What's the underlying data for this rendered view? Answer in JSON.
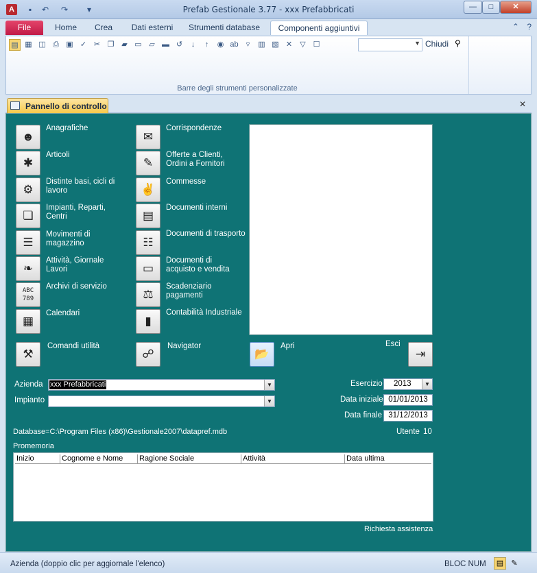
{
  "window": {
    "title": "Prefab Gestionale 3.77 - xxx Prefabbricati",
    "app_icon": "A"
  },
  "ribbon_tabs": [
    {
      "label": "File"
    },
    {
      "label": "Home"
    },
    {
      "label": "Crea"
    },
    {
      "label": "Dati esterni"
    },
    {
      "label": "Strumenti database"
    },
    {
      "label": "Componenti aggiuntivi"
    }
  ],
  "ribbon": {
    "close_label": "Chiudi",
    "group_label": "Barre degli strumenti personalizzate",
    "combo_value": ""
  },
  "doc_tab": {
    "label": "Pannello di controllo"
  },
  "panel": {
    "left_buttons": [
      {
        "label": "Anagrafiche",
        "icon": "person-icon"
      },
      {
        "label": "Articoli",
        "icon": "tools-icon"
      },
      {
        "label": "Distinte basi, cicli di lavoro",
        "icon": "wrench-icon"
      },
      {
        "label": "Impianti,  Reparti, Centri",
        "icon": "squares-icon"
      },
      {
        "label": "Movimenti di magazzino",
        "icon": "list-icon"
      },
      {
        "label": "Attività, Giornale Lavori",
        "icon": "journal-icon"
      },
      {
        "label": "Archivi di servizio",
        "icon": "abc-icon"
      },
      {
        "label": "Calendari",
        "icon": "calendar-icon"
      }
    ],
    "right_buttons": [
      {
        "label": "Corrispondenze",
        "icon": "mail-icon"
      },
      {
        "label": "Offerte a Clienti, Ordini a Fornitori",
        "icon": "edit-icon"
      },
      {
        "label": "Commesse",
        "icon": "handshake-icon"
      },
      {
        "label": "Documenti interni",
        "icon": "document-icon"
      },
      {
        "label": "Documenti di trasporto",
        "icon": "shipping-icon"
      },
      {
        "label": "Documenti di acquisto e vendita",
        "icon": "invoice-icon"
      },
      {
        "label": "Scadenziario pagamenti",
        "icon": "payments-icon"
      },
      {
        "label": "Contabilità Industriale",
        "icon": "chart-icon"
      }
    ],
    "comandi_label": "Comandi utilità",
    "navigator_label": "Navigator",
    "apri_label": "Apri",
    "esci_label": "Esci",
    "azienda_label": "Azienda",
    "azienda_value": "xxx Prefabbricati",
    "impianto_label": "Impianto",
    "impianto_value": "",
    "esercizio_label": "Esercizio",
    "esercizio_value": "2013",
    "data_iniziale_label": "Data iniziale",
    "data_iniziale_value": "01/01/2013",
    "data_finale_label": "Data finale",
    "data_finale_value": "31/12/2013",
    "database_text": "Database=C:\\Program Files (x86)\\Gestionale2007\\datapref.mdb",
    "utente_label": "Utente",
    "utente_value": "10",
    "promemoria_label": "Promemoria",
    "promemoria_columns": [
      "Inizio",
      "Cognome e Nome",
      "Ragione Sociale",
      "Attività",
      "Data ultima"
    ],
    "richiesta_label": "Richiesta assistenza"
  },
  "status": {
    "text": "Azienda (doppio clic per aggiornale l'elenco)",
    "num": "BLOC NUM"
  }
}
